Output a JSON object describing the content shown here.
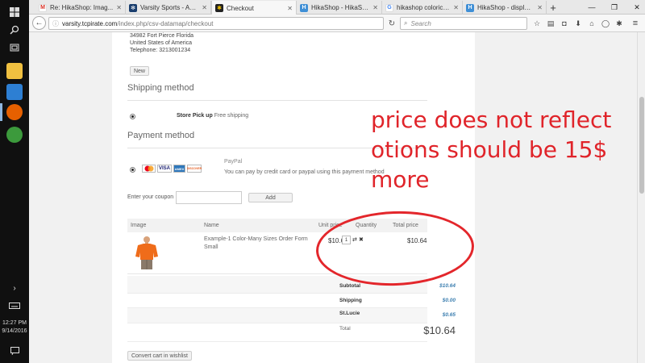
{
  "taskbar": {
    "clock_time": "12:27 PM",
    "clock_date": "9/14/2016"
  },
  "browser": {
    "tabs": [
      {
        "label": "Re: HikaShop: Imag...",
        "icon": "gmail-icon"
      },
      {
        "label": "Varsity Sports - Adm...",
        "icon": "joomla-icon"
      },
      {
        "label": "Checkout",
        "icon": "site-icon",
        "active": true
      },
      {
        "label": "HikaShop - HikaSho...",
        "icon": "hikashop-icon"
      },
      {
        "label": "hikashop coloricon ...",
        "icon": "google-icon"
      },
      {
        "label": "HikaShop - display ...",
        "icon": "hikashop-icon"
      }
    ],
    "url_host": "varsity.tcpirate.com",
    "url_path": "/index.php/csv-datamap/checkout",
    "url_prefix": "",
    "search_placeholder": "Search"
  },
  "checkout": {
    "address": {
      "line1": "34982 Fort Pierce Florida",
      "line2": "United States of America",
      "line3": "Telephone: 3213001234"
    },
    "new_button": "New",
    "shipping": {
      "title": "Shipping method",
      "option_name": "Store Pick up",
      "option_desc": "Free shipping"
    },
    "payment": {
      "title": "Payment method",
      "option_name": "PayPal",
      "option_desc": "You can pay by credit card or paypal using this payment method",
      "logos": [
        "MC",
        "VISA",
        "AMEX",
        "DISCOVER"
      ]
    },
    "coupon": {
      "label": "Enter your coupon",
      "button": "Add"
    },
    "cart": {
      "headers": {
        "image": "Image",
        "name": "Name",
        "unit_price": "Unit price",
        "quantity": "Quantity",
        "total_price": "Total price"
      },
      "item": {
        "name_line1": "Example-1 Color-Many Sizes Order Form",
        "name_line2": "Small",
        "unit_price": "$10.64",
        "quantity": "1",
        "total_price": "$10.64"
      }
    },
    "totals": {
      "subtotal_label": "Subtotal",
      "subtotal_value": "$10.64",
      "shipping_label": "Shipping",
      "shipping_value": "$0.00",
      "tax_label": "St.Lucie",
      "tax_value": "$0.65",
      "total_label": "Total",
      "total_value": "$10.64"
    },
    "wishlist_button": "Convert cart in wishlist"
  },
  "annotation": {
    "line1": "price does not reflect",
    "line2": "otions should be 15$",
    "line3": "more",
    "color": "#e0242a"
  }
}
